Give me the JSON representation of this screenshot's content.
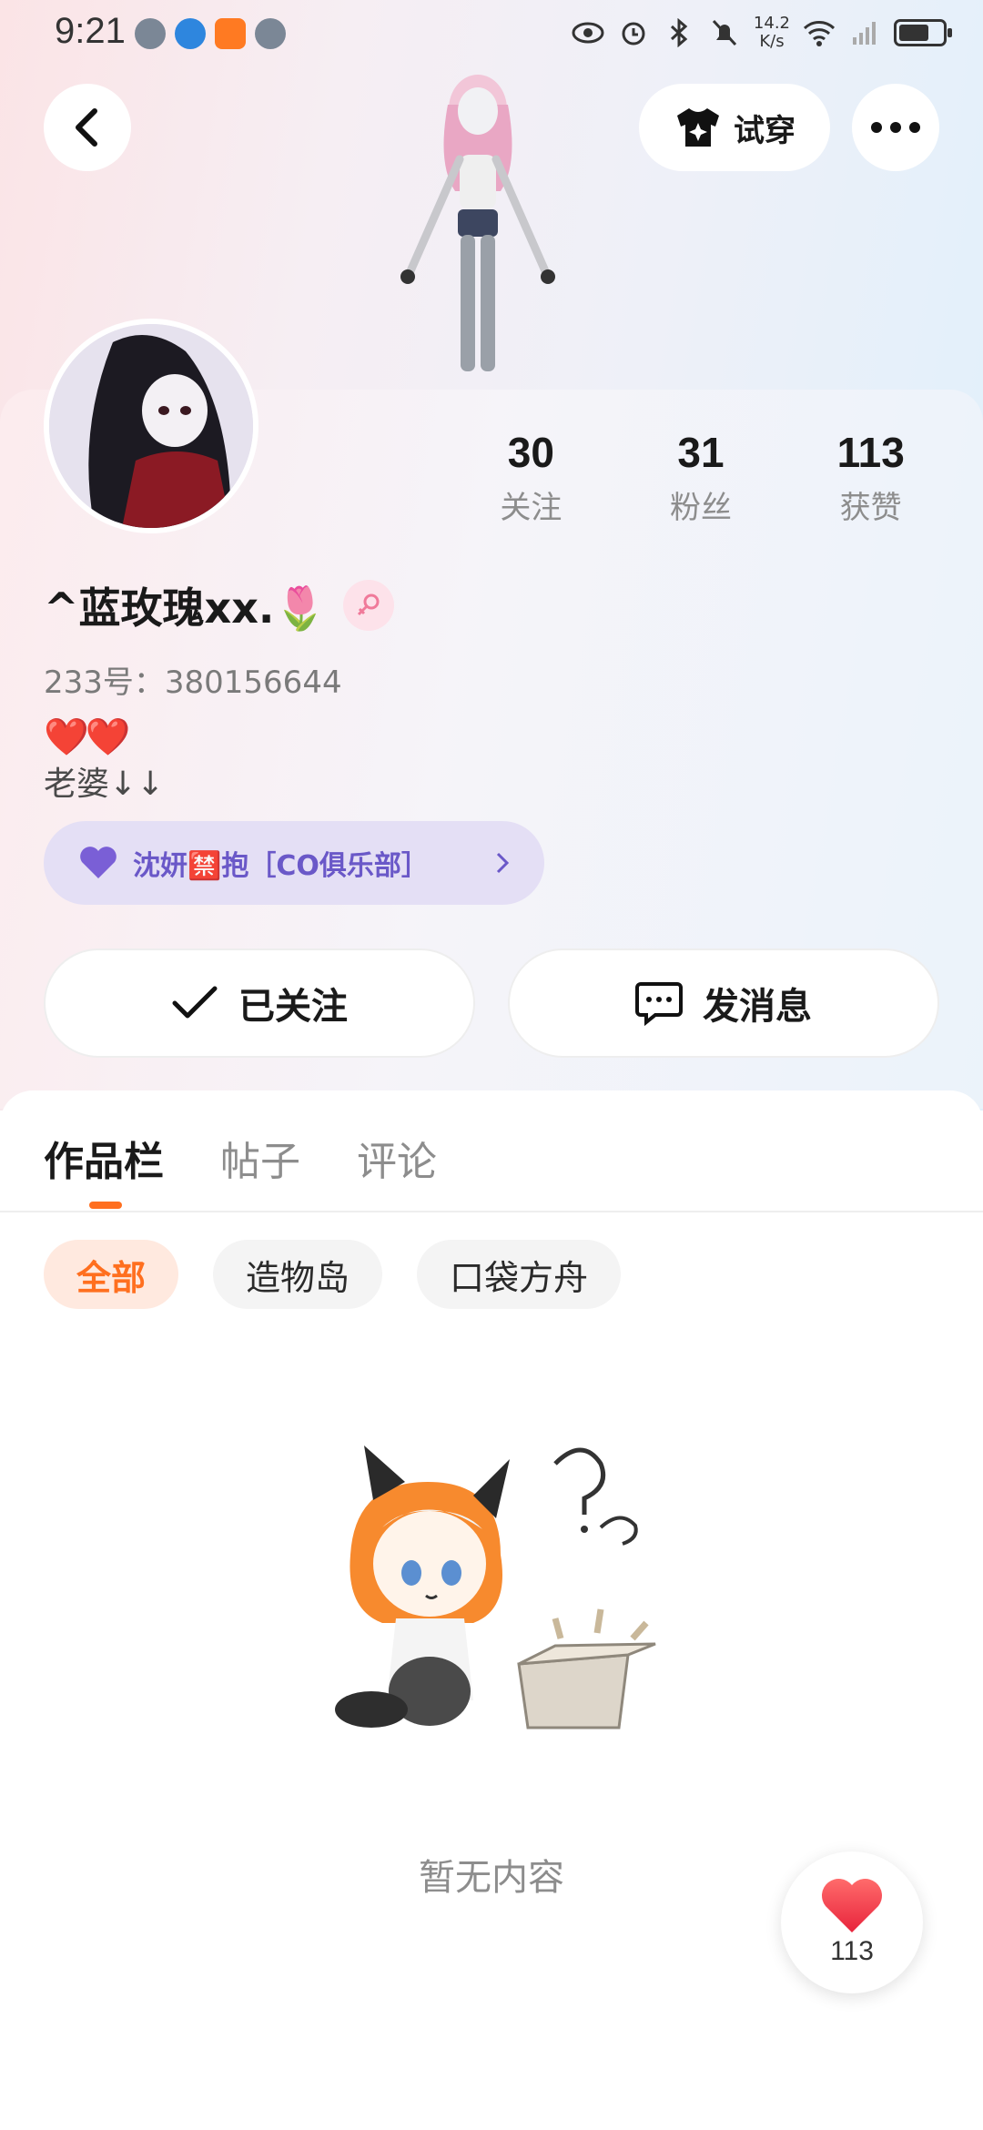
{
  "status_bar": {
    "time": "9:21",
    "net_speed_value": "14.2",
    "net_speed_unit": "K/s",
    "battery_percent": 70
  },
  "header": {
    "try_on_label": "试穿"
  },
  "profile": {
    "nickname": "^蓝玫瑰xx.🌷",
    "uid_text": "233号：380156644",
    "bio_hearts": "❤️❤️",
    "bio_text": "老婆↓↓",
    "club_label": "沈妍🈲抱［CO俱乐部］",
    "stats": [
      {
        "value": "30",
        "label": "关注"
      },
      {
        "value": "31",
        "label": "粉丝"
      },
      {
        "value": "113",
        "label": "获赞"
      }
    ],
    "follow_label": "已关注",
    "message_label": "发消息"
  },
  "content": {
    "tabs": [
      "作品栏",
      "帖子",
      "评论"
    ],
    "chips": [
      "全部",
      "造物岛",
      "口袋方舟"
    ],
    "empty_text": "暂无内容"
  },
  "like_fab": {
    "count": "113"
  },
  "colors": {
    "accent": "#ff6f1f",
    "club_purple": "#6a58c8",
    "heart_red": "#f44a4a"
  }
}
